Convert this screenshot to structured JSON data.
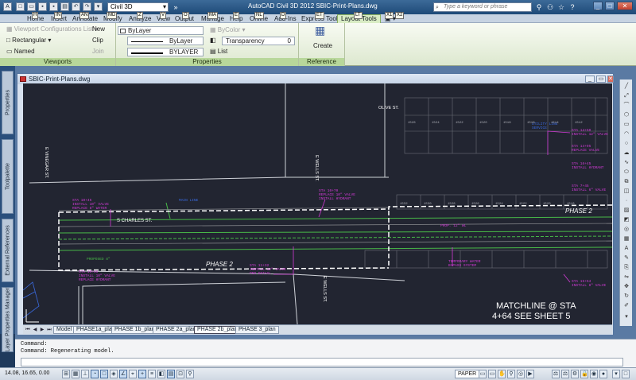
{
  "app_title": "AutoCAD Civil 3D 2012    SBIC-Print-Plans.dwg",
  "workspace": "Civil 3D",
  "search_placeholder": "Type a keyword or phrase",
  "tabs": [
    "Home",
    "Insert",
    "Annotate",
    "Modify",
    "Analyze",
    "View",
    "Output",
    "Manage",
    "Help",
    "Online",
    "Add-Ins",
    "Express Tools",
    "Layout Tools"
  ],
  "keytips": [
    "H",
    "IN",
    "AN",
    "MD",
    "Z",
    "V",
    "O",
    "MA",
    "E",
    "NL",
    "D",
    "ET",
    "LT",
    "X1",
    "X2"
  ],
  "quickaccess_keytips": [
    "1",
    "2",
    "3",
    "4",
    "5",
    "6",
    "7",
    "8",
    "9"
  ],
  "ribbon": {
    "viewports": {
      "title": "Viewports",
      "config": "Viewport Configurations List",
      "rectangular": "Rectangular",
      "named": "Named",
      "new": "New",
      "clip": "Clip",
      "join": "Join"
    },
    "properties": {
      "title": "Properties",
      "bylayer1": "ByLayer",
      "bylayer2": "ByLayer",
      "bylayer3": "BYLAYER",
      "bycolor": "ByColor",
      "transparency": "Transparency",
      "transparency_val": "0",
      "list": "List"
    },
    "refsys": {
      "title": "Reference System",
      "create": "Create"
    }
  },
  "side_tabs": [
    "Properties",
    "Toolpalette",
    "External References",
    "Layer Properties Manager"
  ],
  "drawing": {
    "title": "SBIC-Print-Plans.dwg",
    "labels": {
      "olive": "OLIVE ST.",
      "vinegar": "E VINEGAR ST.",
      "wells1": "E WELLS ST.",
      "wells2": "E WELLS ST.",
      "charles": "S CHARLES ST.",
      "phase2a": "PHASE 2",
      "phase2b": "PHASE 2",
      "match1": "MATCHLINE @ STA",
      "match2": "4+64  SEE SHEET 5"
    }
  },
  "layout_tabs": [
    "Model",
    "PHASE1a_plan",
    "PHASE 1b_plan",
    "PHASE 2a_plan",
    "PHASE 2b_plan",
    "PHASE 3_plan"
  ],
  "layout_active": 4,
  "command_lines": [
    "Command:",
    "Command: Regenerating model."
  ],
  "status": {
    "coords": "14.08, 16.65, 0.00",
    "paper": "PAPER"
  },
  "colors": {
    "canvas": "#222531",
    "magenta": "#d23ad6",
    "green": "#48b848",
    "blue": "#3a6adf",
    "white": "#ffffff",
    "gray": "#8a8c90"
  }
}
